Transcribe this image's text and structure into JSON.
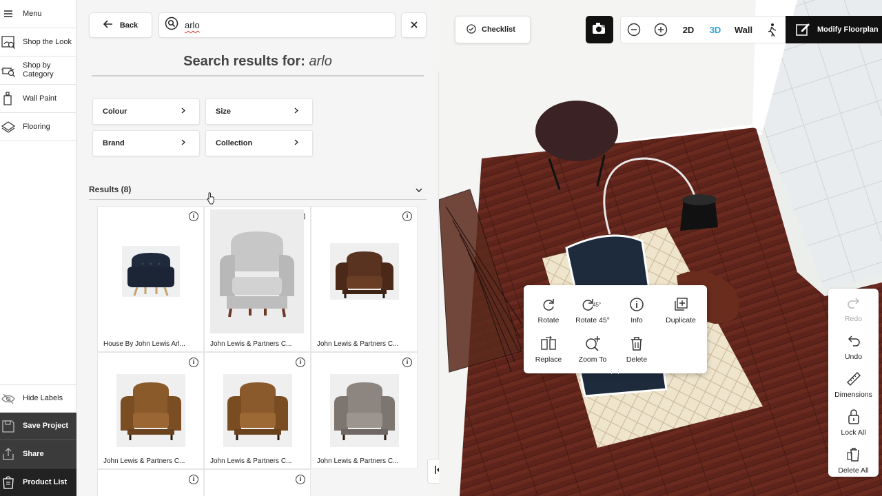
{
  "nav": {
    "menu": "Menu",
    "shop_look": "Shop the Look",
    "shop_category": "Shop by Category",
    "wall_paint": "Wall Paint",
    "flooring": "Flooring",
    "hide_labels": "Hide Labels",
    "save_project": "Save Project",
    "share": "Share",
    "product_list": "Product List"
  },
  "search": {
    "back_label": "Back",
    "query": "arlo",
    "title_prefix": "Search results for:",
    "title_query": "arlo"
  },
  "filters": [
    "Colour",
    "Size",
    "Brand",
    "Collection"
  ],
  "results": {
    "label": "Results (8)",
    "items": [
      {
        "name": "House By John Lewis Arl...",
        "color": "#1f2a3c"
      },
      {
        "name": "John Lewis & Partners C...",
        "color": "#c3c3c3"
      },
      {
        "name": "John Lewis & Partners C...",
        "color": "#5a3320"
      },
      {
        "name": "John Lewis & Partners C...",
        "color": "#8b5a2b"
      },
      {
        "name": "John Lewis & Partners C...",
        "color": "#8a5a2c"
      },
      {
        "name": "John Lewis & Partners C...",
        "color": "#8c8580"
      }
    ]
  },
  "toolbar": {
    "checklist": "Checklist",
    "view_2d": "2D",
    "view_3d": "3D",
    "view_wall": "Wall",
    "modify": "Modify Floorplan",
    "accent": "#2fa3d6"
  },
  "context_menu": {
    "rotate": "Rotate",
    "rotate45": "Rotate 45°",
    "info": "Info",
    "duplicate": "Duplicate",
    "replace": "Replace",
    "zoom_to": "Zoom To",
    "delete": "Delete"
  },
  "side_tools": {
    "redo": "Redo",
    "undo": "Undo",
    "dimensions": "Dimensions",
    "lock_all": "Lock All",
    "delete_all": "Delete All"
  }
}
